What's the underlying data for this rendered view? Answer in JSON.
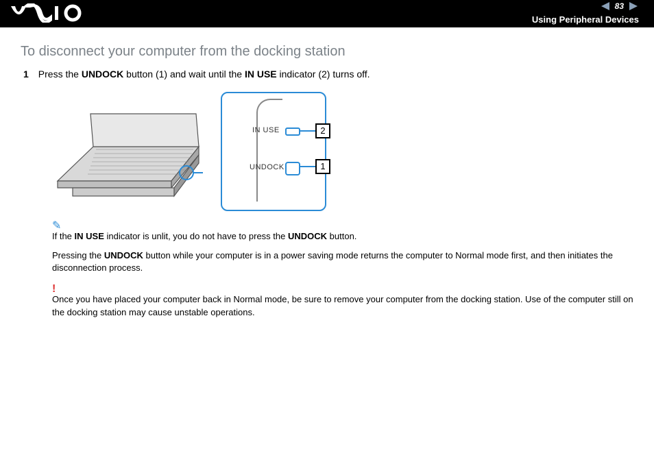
{
  "header": {
    "section_title": "Using Peripheral Devices",
    "page_number": "83"
  },
  "heading": "To disconnect your computer from the docking station",
  "step": {
    "number": "1",
    "before": "Press the ",
    "b1": "UNDOCK",
    "mid1": " button (1) and wait until the ",
    "b2": "IN USE",
    "after": " indicator (2) turns off."
  },
  "figure": {
    "label_inuse": "IN USE",
    "label_undock": "UNDOCK",
    "num1": "1",
    "num2": "2"
  },
  "note1": {
    "before": "If the ",
    "b1": "IN USE",
    "mid": " indicator is unlit, you do not have to press the ",
    "b2": "UNDOCK",
    "after": " button."
  },
  "paragraph": {
    "before": "Pressing the ",
    "b1": "UNDOCK",
    "after": " button while your computer is in a power saving mode returns the computer to Normal mode first, and then initiates the disconnection process."
  },
  "caution": "Once you have placed your computer back in Normal mode, be sure to remove your computer from the docking station. Use of the computer still on the docking station may cause unstable operations."
}
